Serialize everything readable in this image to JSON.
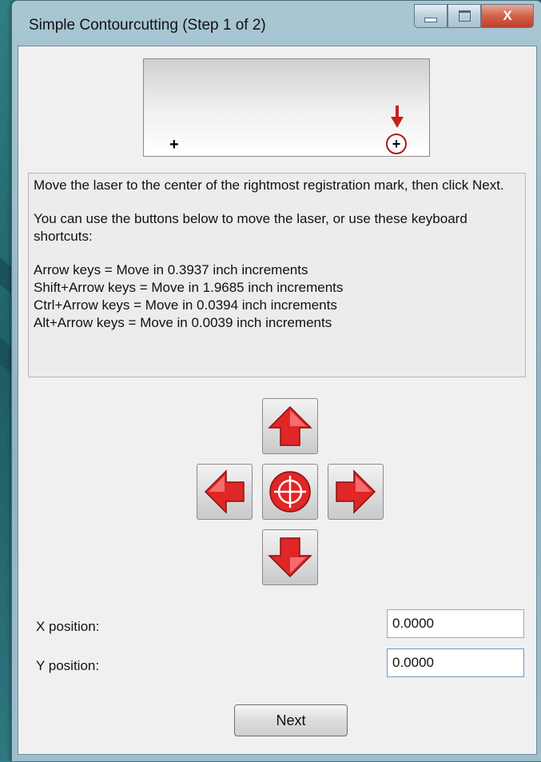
{
  "window": {
    "title": "Simple Contourcutting (Step 1 of 2)",
    "close_glyph": "X"
  },
  "instructions": {
    "line1": "Move the laser to the center of the rightmost registration mark, then click Next.",
    "line2": "You can use the buttons below to move the laser, or use these keyboard shortcuts:",
    "shortcuts": [
      "Arrow keys = Move in 0.3937 inch increments",
      "Shift+Arrow keys = Move in 1.9685 inch increments",
      "Ctrl+Arrow keys = Move in 0.0394 inch increments",
      "Alt+Arrow keys = Move in 0.0039 inch increments"
    ]
  },
  "fields": {
    "x_label": "X position:",
    "x_value": "0.0000",
    "y_label": "Y position:",
    "y_value": "0.0000"
  },
  "buttons": {
    "next_label": "Next"
  },
  "colors": {
    "arrow_red": "#e02626",
    "arrow_light": "#ff8c8c",
    "indicator_red": "#c62020"
  }
}
